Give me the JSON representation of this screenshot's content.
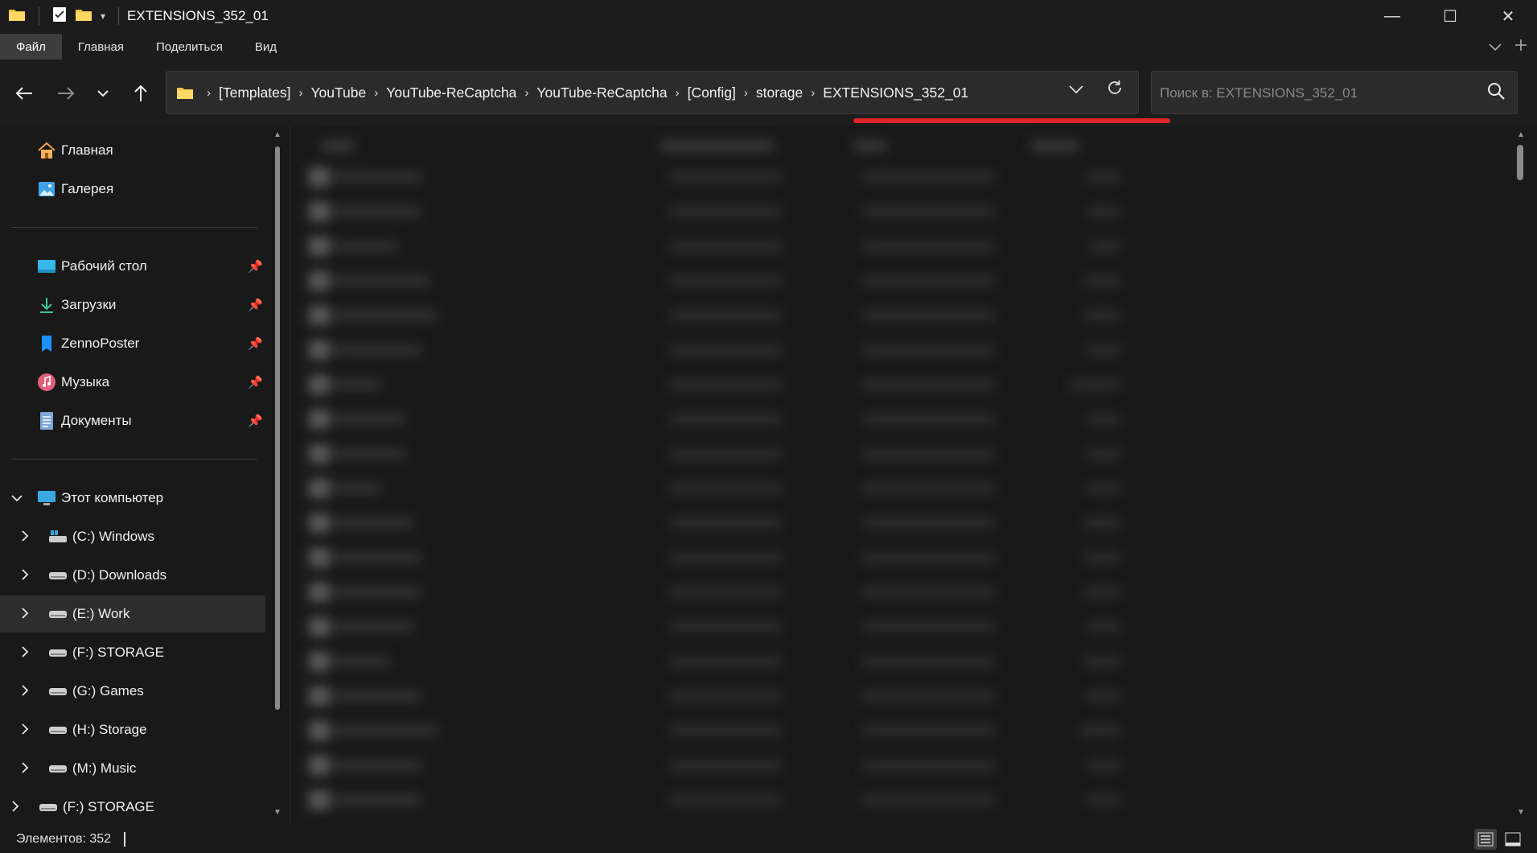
{
  "window": {
    "title": "EXTENSIONS_352_01",
    "minimize_glyph": "—",
    "maximize_glyph": "☐",
    "close_glyph": "✕"
  },
  "ribbon": {
    "tabs": [
      {
        "label": "Файл",
        "active": true
      },
      {
        "label": "Главная",
        "active": false
      },
      {
        "label": "Поделиться",
        "active": false
      },
      {
        "label": "Вид",
        "active": false
      }
    ]
  },
  "address": {
    "crumbs": [
      "[Templates]",
      "YouTube",
      "YouTube-ReCaptcha",
      "YouTube-ReCaptcha",
      "[Config]",
      "storage",
      "EXTENSIONS_352_01"
    ],
    "highlight_color": "#e0252a"
  },
  "search": {
    "placeholder": "Поиск в: EXTENSIONS_352_01",
    "value": ""
  },
  "sidebar": {
    "quick": [
      {
        "label": "Главная",
        "icon": "home-icon"
      },
      {
        "label": "Галерея",
        "icon": "gallery-icon"
      }
    ],
    "pinned": [
      {
        "label": "Рабочий стол",
        "icon": "desktop-icon"
      },
      {
        "label": "Загрузки",
        "icon": "download-icon"
      },
      {
        "label": "ZennoPoster",
        "icon": "folder-icon"
      },
      {
        "label": "Музыка",
        "icon": "music-icon"
      },
      {
        "label": "Документы",
        "icon": "documents-icon"
      }
    ],
    "this_pc": {
      "label": "Этот компьютер",
      "icon": "computer-icon"
    },
    "drives": [
      {
        "label": "(C:) Windows",
        "icon": "windows-drive-icon"
      },
      {
        "label": "(D:) Downloads",
        "icon": "drive-icon"
      },
      {
        "label": "(E:) Work",
        "icon": "drive-icon",
        "selected": true
      },
      {
        "label": "(F:) STORAGE",
        "icon": "drive-icon"
      },
      {
        "label": "(G:) Games",
        "icon": "drive-icon"
      },
      {
        "label": "(H:) Storage",
        "icon": "drive-icon"
      },
      {
        "label": "(M:) Music",
        "icon": "drive-icon"
      }
    ],
    "network_drive": {
      "label": "(F:) STORAGE",
      "icon": "drive-icon"
    }
  },
  "status": {
    "items_count": "Элементов: 352"
  },
  "colors": {
    "background": "#191919",
    "chrome": "#1c1c1c",
    "accent_underline": "#e0252a"
  }
}
